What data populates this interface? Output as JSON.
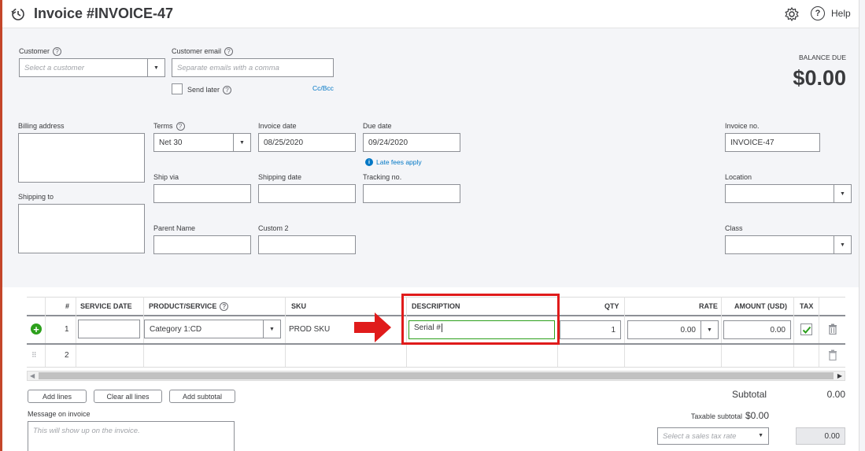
{
  "header": {
    "title": "Invoice #INVOICE-47",
    "help_label": "Help"
  },
  "customer": {
    "label": "Customer",
    "placeholder": "Select a customer"
  },
  "customer_email": {
    "label": "Customer email",
    "placeholder": "Separate emails with a comma",
    "send_later": "Send later",
    "cc_bcc": "Cc/Bcc"
  },
  "balance": {
    "label": "BALANCE DUE",
    "amount": "$0.00"
  },
  "billing_address": {
    "label": "Billing address"
  },
  "shipping_to": {
    "label": "Shipping to"
  },
  "terms": {
    "label": "Terms",
    "value": "Net 30"
  },
  "invoice_date": {
    "label": "Invoice date",
    "value": "08/25/2020"
  },
  "due_date": {
    "label": "Due date",
    "value": "09/24/2020",
    "late_fees": "Late fees apply"
  },
  "invoice_no": {
    "label": "Invoice no.",
    "value": "INVOICE-47"
  },
  "ship_via": {
    "label": "Ship via"
  },
  "shipping_date": {
    "label": "Shipping date"
  },
  "tracking_no": {
    "label": "Tracking no."
  },
  "location": {
    "label": "Location"
  },
  "parent_name": {
    "label": "Parent Name"
  },
  "custom2": {
    "label": "Custom 2"
  },
  "class_field": {
    "label": "Class"
  },
  "table": {
    "headers": {
      "num": "#",
      "service_date": "SERVICE DATE",
      "product": "PRODUCT/SERVICE",
      "sku": "SKU",
      "description": "DESCRIPTION",
      "qty": "QTY",
      "rate": "RATE",
      "amount": "AMOUNT (USD)",
      "tax": "TAX"
    },
    "rows": [
      {
        "num": "1",
        "product": "Category 1:CD",
        "sku": "PROD SKU",
        "description": "Serial #",
        "qty": "1",
        "rate": "0.00",
        "amount": "0.00"
      },
      {
        "num": "2"
      }
    ]
  },
  "buttons": {
    "add_lines": "Add lines",
    "clear_all_lines": "Clear all lines",
    "add_subtotal": "Add subtotal"
  },
  "totals": {
    "subtotal_label": "Subtotal",
    "subtotal_value": "0.00",
    "taxable_label": "Taxable subtotal",
    "taxable_value": "$0.00",
    "tax_rate_placeholder": "Select a sales tax rate",
    "tax_value": "0.00"
  },
  "message": {
    "label": "Message on invoice",
    "placeholder": "This will show up on the invoice."
  },
  "colors": {
    "accent_red": "#e01b1b",
    "green": "#2ca01c",
    "link_blue": "#0077c5"
  }
}
